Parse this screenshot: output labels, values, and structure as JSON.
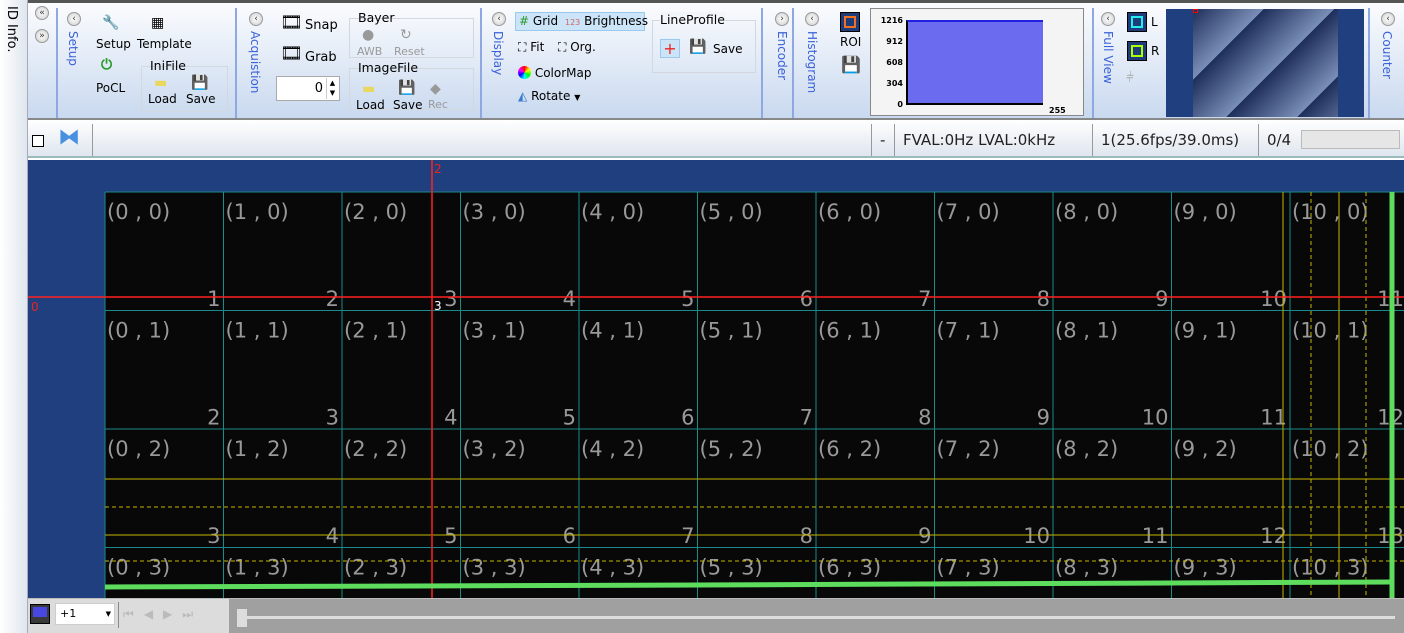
{
  "side_tab": "ID Info.",
  "ribbon": {
    "groups": [
      "Setup",
      "Acquistion",
      "Display",
      "Encoder",
      "Histogram",
      "Full View",
      "Counter"
    ],
    "setup": {
      "setup": "Setup",
      "template": "Template",
      "pocl": "PoCL",
      "inifile": "IniFile",
      "load": "Load",
      "save": "Save"
    },
    "acq": {
      "snap": "Snap",
      "grab": "Grab",
      "count": "0",
      "bayer": "Bayer",
      "awb": "AWB",
      "reset": "Reset",
      "imagefile": "ImageFile",
      "load": "Load",
      "save": "Save",
      "rec": "Rec"
    },
    "display": {
      "grid": "Grid",
      "brightness": "Brightness",
      "fit": "Fit",
      "org": "Org.",
      "colormap": "ColorMap",
      "rotate": "Rotate",
      "lineprofile": "LineProfile",
      "save": "Save"
    },
    "histogram": {
      "roi": "ROI",
      "yticks": [
        "1216",
        "912",
        "608",
        "304",
        "0"
      ],
      "xmax": "255",
      "color": "#6b6bf0"
    },
    "fullview": {
      "l": "L",
      "r": "R"
    }
  },
  "status": {
    "dash": "-",
    "signal": "FVAL:0Hz  LVAL:0kHz",
    "fps": "1(25.6fps/39.0ms)",
    "frames": "0/4"
  },
  "view": {
    "cross_x": "2",
    "cross_y": "0",
    "cross_val": "3",
    "cols": 11,
    "rows": 4
  },
  "bottom": {
    "step": "+1"
  }
}
